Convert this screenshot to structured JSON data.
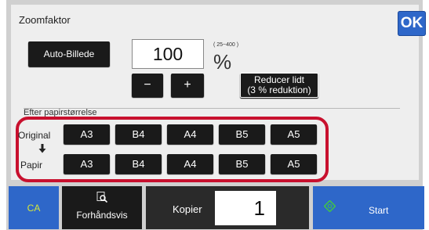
{
  "dialog": {
    "title": "Zoomfaktor",
    "ok_label": "OK",
    "auto_label": "Auto-Billede",
    "zoom_value": "100",
    "range_text": "( 25~400 )",
    "percent_symbol": "%",
    "minus_label": "−",
    "plus_label": "+",
    "reduce_line1": "Reducer lidt",
    "reduce_line2": "(3 % reduktion)",
    "paper_size_label": "Efter papirstørrelse"
  },
  "sizes": {
    "original_label": "Original",
    "paper_label": "Papir",
    "original": [
      "A3",
      "B4",
      "A4",
      "B5",
      "A5"
    ],
    "paper": [
      "A3",
      "B4",
      "A4",
      "B5",
      "A5"
    ]
  },
  "bottom": {
    "ca_label": "CA",
    "preview_label": "Forhåndsvis",
    "copies_label": "Kopier",
    "copies_value": "1",
    "start_label": "Start"
  },
  "colors": {
    "accent_blue": "#2e67c9",
    "frame_red": "#c8102e",
    "ca_text": "#d6e63a",
    "start_icon": "#3fbf4f"
  }
}
